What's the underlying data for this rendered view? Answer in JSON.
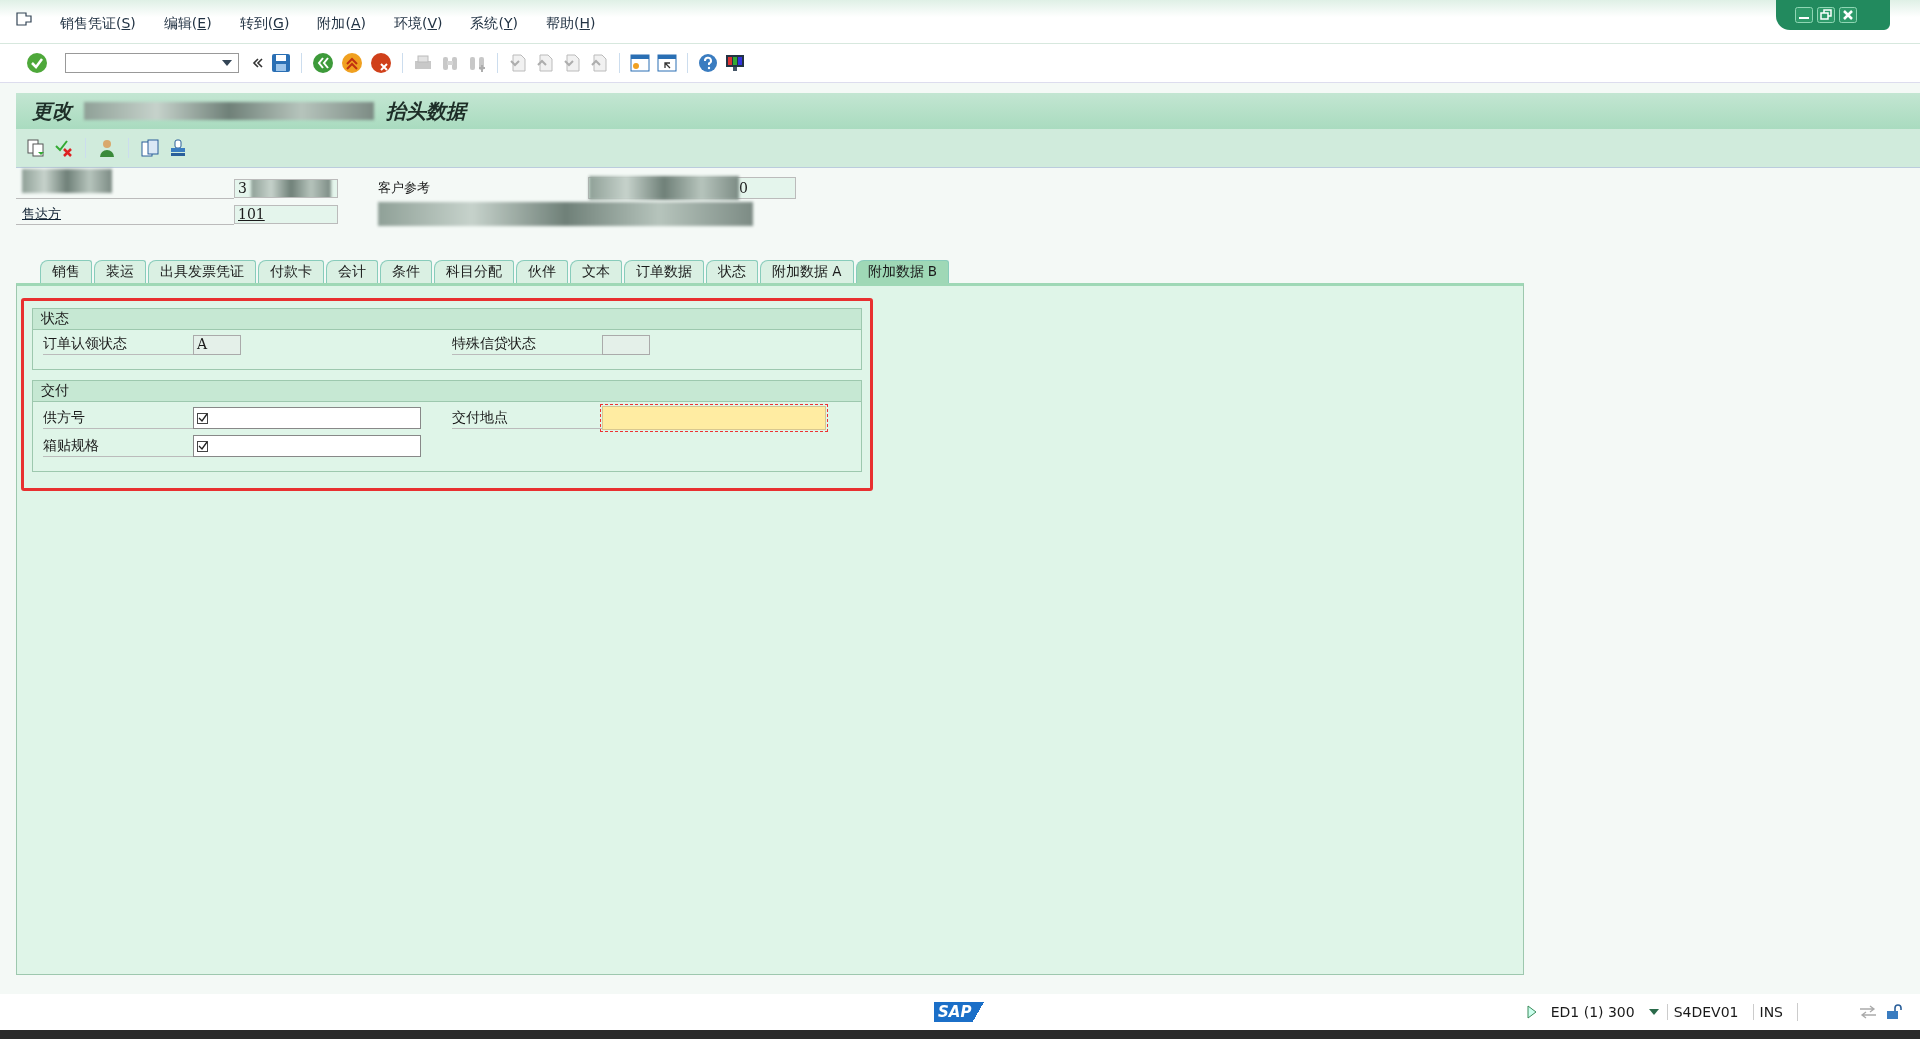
{
  "menu": [
    {
      "label": "销售凭证(S)"
    },
    {
      "label": "编辑(E)"
    },
    {
      "label": "转到(G)"
    },
    {
      "label": "附加(A)"
    },
    {
      "label": "环境(V)"
    },
    {
      "label": "系统(Y)"
    },
    {
      "label": "帮助(H)"
    }
  ],
  "title": {
    "prefix": "更改",
    "suffix": "抬头数据"
  },
  "header": {
    "rows": [
      {
        "kind": "redacted",
        "value": "3"
      },
      {
        "kind": "link",
        "label": "售达方",
        "value": "101"
      }
    ],
    "customer_ref": {
      "label": "客户参考",
      "value": "0"
    }
  },
  "tabs": [
    {
      "label": "销售",
      "selected": false
    },
    {
      "label": "装运",
      "selected": false
    },
    {
      "label": "出具发票凭证",
      "selected": false
    },
    {
      "label": "付款卡",
      "selected": false
    },
    {
      "label": "会计",
      "selected": false
    },
    {
      "label": "条件",
      "selected": false
    },
    {
      "label": "科目分配",
      "selected": false
    },
    {
      "label": "伙伴",
      "selected": false
    },
    {
      "label": "文本",
      "selected": false
    },
    {
      "label": "订单数据",
      "selected": false
    },
    {
      "label": "状态",
      "selected": false
    },
    {
      "label": "附加数据 A",
      "selected": false
    },
    {
      "label": "附加数据 B",
      "selected": true
    }
  ],
  "sections": [
    {
      "title": "状态",
      "rows": [
        [
          {
            "label": "订单认领状态",
            "kind": "display",
            "value": "A"
          },
          {
            "label": "特殊信贷状态",
            "kind": "display"
          }
        ]
      ]
    },
    {
      "title": "交付",
      "rows": [
        [
          {
            "label": "供方号",
            "kind": "checkbox-input",
            "checked": true
          },
          {
            "label": "交付地点",
            "kind": "required"
          }
        ],
        [
          {
            "label": "箱贴规格",
            "kind": "checkbox-input",
            "checked": true
          }
        ]
      ]
    }
  ],
  "status_bar": {
    "logo": "SAP",
    "system": "ED1 (1) 300",
    "server": "S4DEV01",
    "mode": "INS"
  }
}
